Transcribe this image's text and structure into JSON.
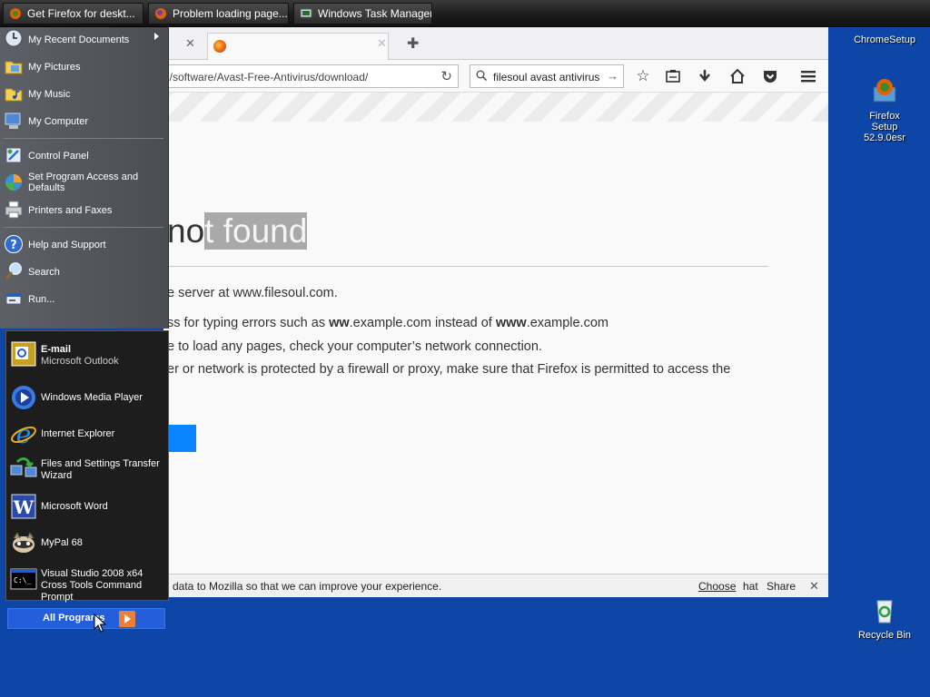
{
  "taskbar": {
    "buttons": [
      {
        "label": "Get Firefox for deskt...",
        "icon": "firefox-setup-icon"
      },
      {
        "label": "Problem loading page...",
        "icon": "firefox-icon"
      },
      {
        "label": "Windows Task Manager",
        "icon": "task-manager-icon"
      }
    ]
  },
  "firefox": {
    "tab_close": "✕",
    "url": "n/software/Avast-Free-Antivirus/download/",
    "search_query": "filesoul avast antivirus",
    "error": {
      "title_plain": "no",
      "title_highlight": "t found",
      "lines": [
        {
          "pre": "e server at www.filesoul.com.",
          "b1": "",
          "mid": "",
          "b2": "",
          "post": ""
        },
        {
          "pre": "ss for typing errors such as ",
          "b1": "ww",
          "mid": ".example.com instead of ",
          "b2": "www",
          "post": ".example.com"
        },
        {
          "pre": "e to load any pages, check your computer’s network connection.",
          "b1": "",
          "mid": "",
          "b2": "",
          "post": ""
        },
        {
          "pre": "er or network is protected by a firewall or proxy, make sure that Firefox is permitted to access the",
          "b1": "",
          "mid": "",
          "b2": "",
          "post": ""
        }
      ]
    },
    "infobar": {
      "message": "data to Mozilla so that we can improve your experience.",
      "choose": "Choose",
      "hat": "hat",
      "share": "Share",
      "close": "✕"
    }
  },
  "desktop": {
    "icons": [
      {
        "label": "ChromeSetup",
        "icon": "chrome-setup-icon"
      },
      {
        "label": "Firefox Setup 52.9.0esr",
        "icon": "firefox-setup-icon"
      },
      {
        "label": "Recycle Bin",
        "icon": "recycle-bin-icon"
      }
    ]
  },
  "start_menu": {
    "right_items": [
      {
        "label": "My Recent Documents",
        "icon": "recent-documents-icon"
      },
      {
        "label": "My Pictures",
        "icon": "pictures-folder-icon"
      },
      {
        "label": "My Music",
        "icon": "music-folder-icon"
      },
      {
        "label": "My Computer",
        "icon": "computer-icon"
      },
      {
        "label": "Control Panel",
        "icon": "control-panel-icon"
      },
      {
        "label": "Set Program Access and Defaults",
        "icon": "program-defaults-icon"
      },
      {
        "label": "Printers and Faxes",
        "icon": "printer-icon"
      },
      {
        "label": "Help and Support",
        "icon": "help-icon"
      },
      {
        "label": "Search",
        "icon": "search-icon"
      },
      {
        "label": "Run...",
        "icon": "run-icon"
      }
    ],
    "pinned": [
      {
        "label": "E-mail",
        "sub": "Microsoft Outlook",
        "icon": "outlook-icon"
      },
      {
        "label": "Windows Media Player",
        "sub": "",
        "icon": "media-player-icon"
      },
      {
        "label": "Internet Explorer",
        "sub": "",
        "icon": "internet-explorer-icon"
      },
      {
        "label": "Files and Settings Transfer Wizard",
        "sub": "",
        "icon": "transfer-wizard-icon"
      },
      {
        "label": "Microsoft Word",
        "sub": "",
        "icon": "word-icon"
      },
      {
        "label": "MyPal 68",
        "sub": "",
        "icon": "mypal-icon"
      },
      {
        "label": "Visual Studio 2008 x64 Cross Tools Command Prompt",
        "sub": "",
        "icon": "command-prompt-icon"
      }
    ],
    "all_programs": "All Programs"
  }
}
